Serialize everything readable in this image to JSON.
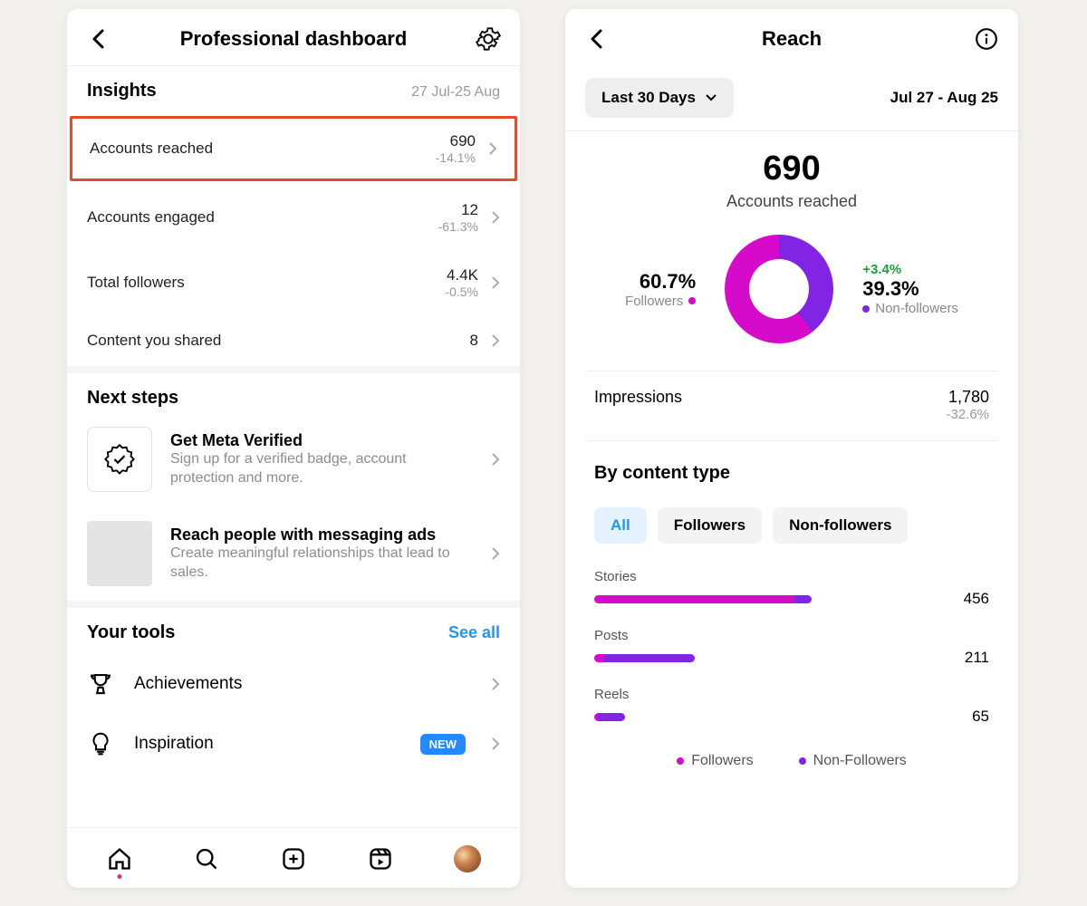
{
  "left": {
    "title": "Professional dashboard",
    "insights_title": "Insights",
    "date_range": "27 Jul-25 Aug",
    "metrics": [
      {
        "label": "Accounts reached",
        "value": "690",
        "delta": "-14.1%"
      },
      {
        "label": "Accounts engaged",
        "value": "12",
        "delta": "-61.3%"
      },
      {
        "label": "Total followers",
        "value": "4.4K",
        "delta": "-0.5%"
      },
      {
        "label": "Content you shared",
        "value": "8",
        "delta": ""
      }
    ],
    "next_steps_title": "Next steps",
    "next_steps": [
      {
        "title": "Get Meta Verified",
        "desc": "Sign up for a verified badge, account protection and more."
      },
      {
        "title": "Reach people with messaging ads",
        "desc": "Create meaningful relationships that lead to sales."
      }
    ],
    "tools_title": "Your tools",
    "tools_link": "See all",
    "tools": [
      {
        "label": "Achievements"
      },
      {
        "label": "Inspiration",
        "badge": "NEW"
      }
    ]
  },
  "right": {
    "title": "Reach",
    "range_chip": "Last 30 Days",
    "range_dates": "Jul 27 - Aug 25",
    "hero_value": "690",
    "hero_label": "Accounts reached",
    "followers_pct": "60.7%",
    "followers_lbl": "Followers",
    "nonfollowers_pct": "39.3%",
    "nonfollowers_lbl": "Non-followers",
    "nonfollowers_delta": "+3.4%",
    "impressions_label": "Impressions",
    "impressions_value": "1,780",
    "impressions_delta": "-32.6%",
    "content_type_title": "By content type",
    "pills": {
      "all": "All",
      "followers": "Followers",
      "nonfollowers": "Non-followers"
    },
    "bars": [
      {
        "label": "Stories",
        "value": "456"
      },
      {
        "label": "Posts",
        "value": "211"
      },
      {
        "label": "Reels",
        "value": "65"
      }
    ],
    "legend_followers": "Followers",
    "legend_nonfollowers": "Non-Followers"
  },
  "chart_data": {
    "donut": {
      "type": "pie",
      "title": "Accounts reached",
      "total": 690,
      "series": [
        {
          "name": "Followers",
          "value": 60.7,
          "color": "#d60acb"
        },
        {
          "name": "Non-followers",
          "value": 39.3,
          "delta": "+3.4%",
          "color": "#8224e3"
        }
      ]
    },
    "content_type": {
      "type": "bar",
      "title": "By content type",
      "max": 456,
      "categories": [
        "Stories",
        "Posts",
        "Reels"
      ],
      "series": [
        {
          "name": "Followers",
          "color": "#d60acb",
          "values": [
            420,
            20,
            7
          ]
        },
        {
          "name": "Non-followers",
          "color": "#8224e3",
          "values": [
            36,
            191,
            58
          ]
        }
      ],
      "totals": [
        456,
        211,
        65
      ]
    }
  }
}
